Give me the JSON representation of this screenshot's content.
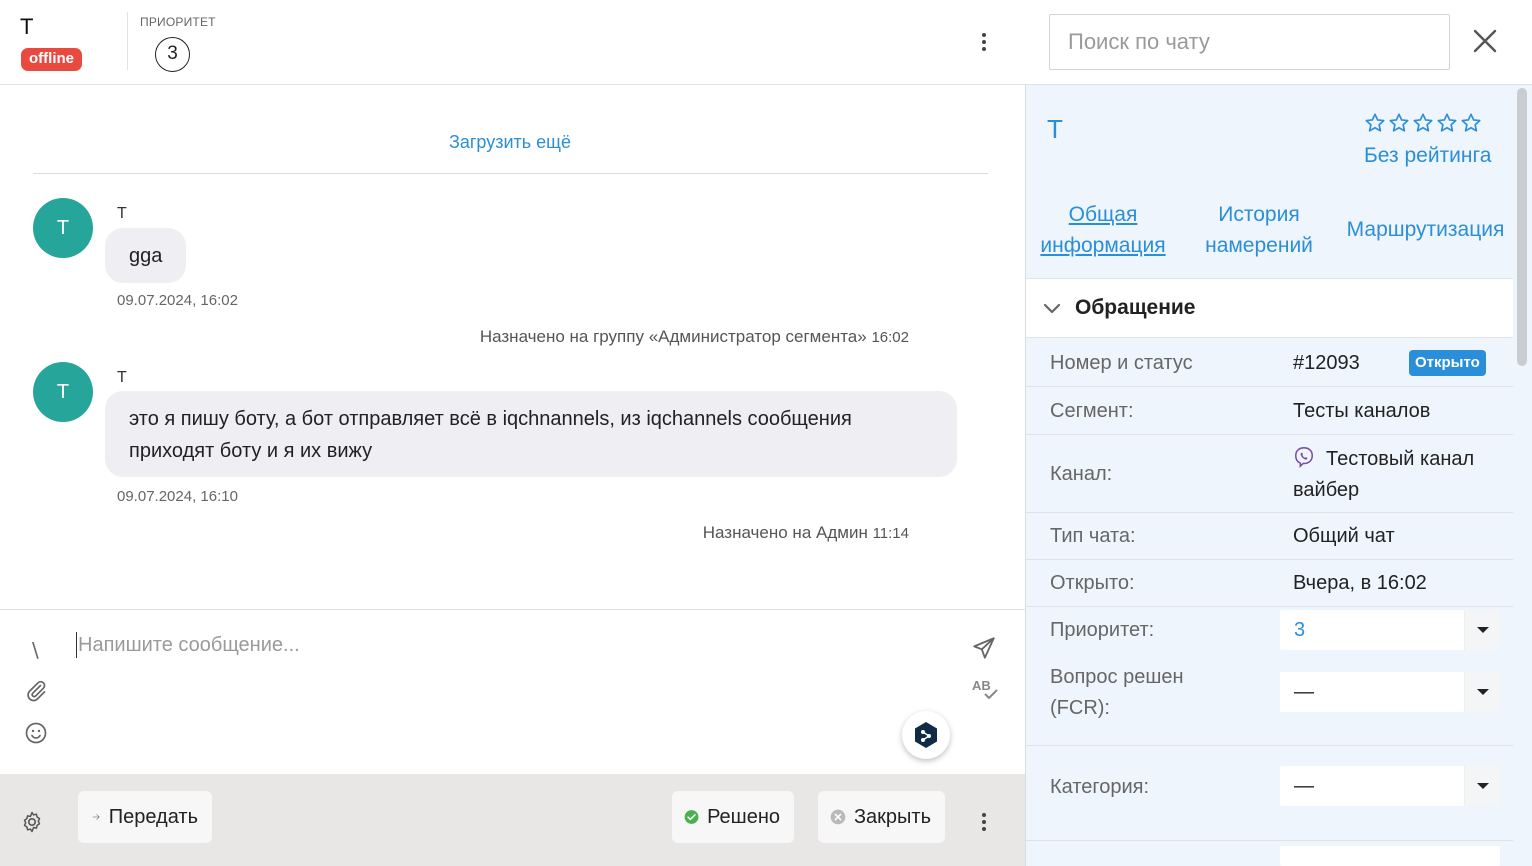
{
  "chat_header": {
    "contact_name": "Т",
    "status": "offline",
    "priority_label": "ПРИОРИТЕТ",
    "priority_value": "3"
  },
  "messages": {
    "load_more": "Загрузить ещё",
    "items": [
      {
        "avatar": "Т",
        "sender": "Т",
        "text": "gga",
        "time": "09.07.2024, 16:02"
      },
      {
        "avatar": "Т",
        "sender": "Т",
        "text_line1": "это я пишу боту, а бот отправляет всё в iqchnannels, из iqchannels сообщения",
        "text_line2": "приходят боту и я их вижу",
        "time": "09.07.2024, 16:10"
      }
    ],
    "system": [
      {
        "text": "Назначено на группу «Администратор сегмента»",
        "time": "16:02"
      },
      {
        "text": "Назначено на Админ",
        "time": "11:14"
      }
    ]
  },
  "composer": {
    "placeholder": "Напишите сообщение...",
    "shortcut_char": "\\",
    "spellcheck_label": "AB"
  },
  "footer": {
    "transfer_label": "Передать",
    "resolved_label": "Решено",
    "close_label": "Закрыть"
  },
  "sidebar": {
    "search_placeholder": "Поиск по чату",
    "profile_name": "Т",
    "rating_label": "Без рейтинга",
    "tabs": [
      {
        "line1": "Общая",
        "line2": "информация"
      },
      {
        "line1": "История",
        "line2": "намерений"
      },
      {
        "line1": "Маршрутизация"
      }
    ],
    "section_title": "Обращение",
    "fields": {
      "number_label": "Номер и статус",
      "number_value": "#12093",
      "status_value": "Открыто",
      "segment_label": "Сегмент:",
      "segment_value": "Тесты каналов",
      "channel_label": "Канал:",
      "channel_value_line1": "Тестовый канал",
      "channel_value_line2": "вайбер",
      "chat_type_label": "Тип чата:",
      "chat_type_value": "Общий чат",
      "opened_label": "Открыто:",
      "opened_value": "Вчера, в 16:02",
      "priority_label": "Приоритет:",
      "priority_value": "3",
      "fcr_label_line1": "Вопрос решен",
      "fcr_label_line2": "(FCR):",
      "fcr_value": "—",
      "category_label": "Категория:",
      "category_value": "—"
    }
  },
  "colors": {
    "accent": "#2b8ed8",
    "offline": "#e84a3f",
    "avatar": "#26a69a",
    "resolved": "#4caf50",
    "viber": "#7b519d"
  }
}
